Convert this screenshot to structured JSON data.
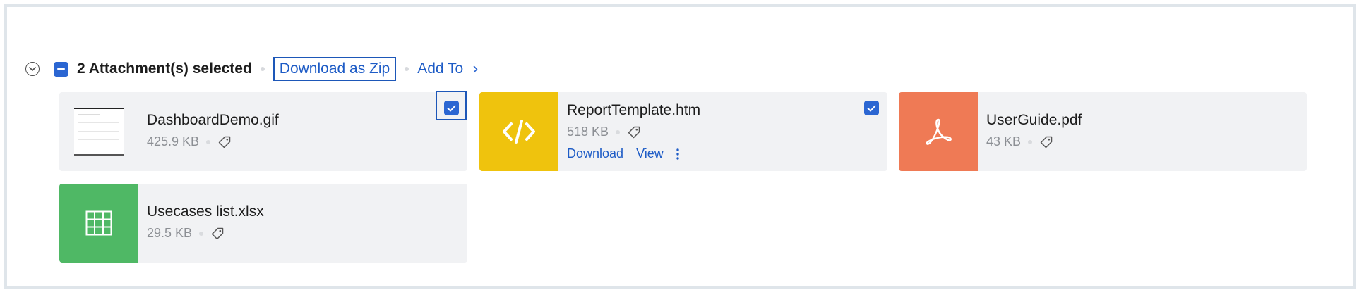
{
  "header": {
    "selection_text": "2 Attachment(s) selected",
    "download_zip_label": "Download as Zip",
    "add_to_label": "Add To"
  },
  "attachments": [
    {
      "name": "DashboardDemo.gif",
      "size": "425.9 KB",
      "selected": true,
      "icon": "image-thumbnail"
    },
    {
      "name": "ReportTemplate.htm",
      "size": "518 KB",
      "selected": true,
      "icon": "code-icon",
      "color": "#efc30d",
      "actions": {
        "download": "Download",
        "view": "View"
      }
    },
    {
      "name": "UserGuide.pdf",
      "size": "43 KB",
      "selected": false,
      "icon": "pdf-icon",
      "color": "#ef7a55"
    },
    {
      "name": "Usecases list.xlsx",
      "size": "29.5 KB",
      "selected": false,
      "icon": "spreadsheet-icon",
      "color": "#4fb865"
    }
  ],
  "colors": {
    "accent": "#2b66d2",
    "link": "#1e5cc6",
    "card_bg": "#f1f2f4"
  }
}
